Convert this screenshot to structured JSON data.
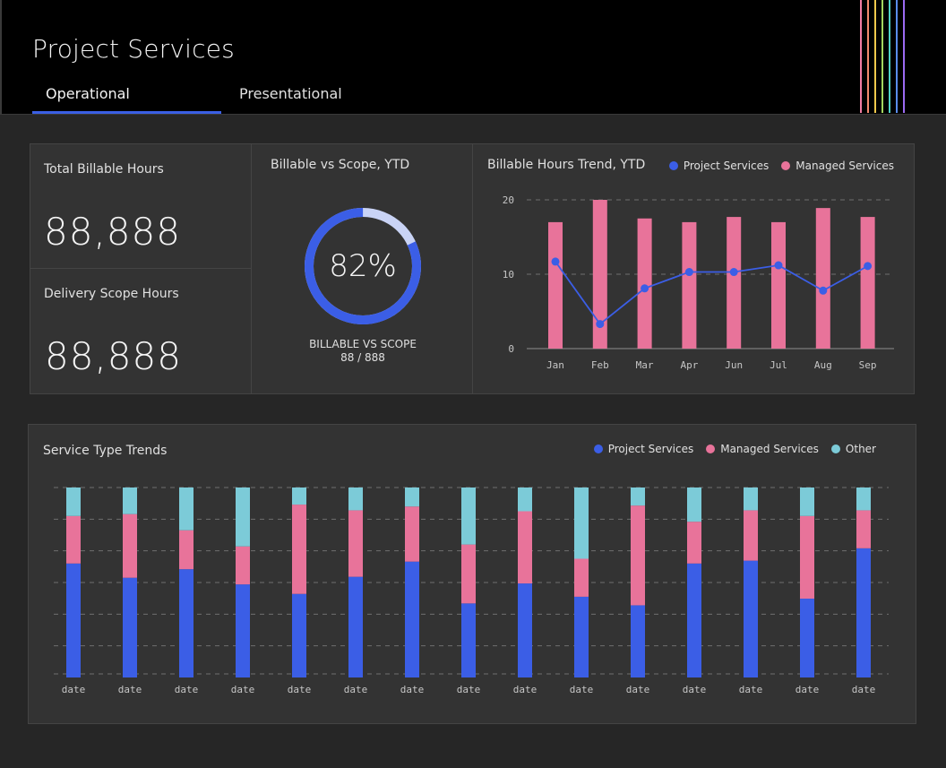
{
  "app": {
    "title": "Project Services"
  },
  "tabs": [
    {
      "label": "Operational",
      "active": true
    },
    {
      "label": "Presentational",
      "active": false
    }
  ],
  "header_stripes": [
    "#f27da3",
    "#f28b6e",
    "#f2c94c",
    "#a4d65e",
    "#4fd1c5",
    "#5a8df0",
    "#9b6bf2"
  ],
  "kpis": {
    "total_billable": {
      "label": "Total Billable Hours",
      "value": "88,888"
    },
    "delivery_scope": {
      "label": "Delivery Scope Hours",
      "value": "88,888"
    }
  },
  "gauge": {
    "title": "Billable vs Scope, YTD",
    "percent_label": "82%",
    "percent": 82,
    "caption": "BILLABLE VS SCOPE",
    "ratio": "88 / 888"
  },
  "colors": {
    "project": "#3b5ee6",
    "managed": "#e8739a",
    "other": "#7ccbd8",
    "gauge_track": "#c9d3f5"
  },
  "trend": {
    "title": "Billable Hours Trend, YTD",
    "legend": [
      "Project Services",
      "Managed Services"
    ]
  },
  "service": {
    "title": "Service Type Trends",
    "legend": [
      "Project Services",
      "Managed Services",
      "Other"
    ]
  },
  "chart_data": [
    {
      "type": "bar",
      "title": "Billable Hours Trend, YTD",
      "categories": [
        "Jan",
        "Feb",
        "Mar",
        "Apr",
        "Jun",
        "Jul",
        "Aug",
        "Sep"
      ],
      "ylim": [
        0,
        20
      ],
      "yticks": [
        0,
        10,
        20
      ],
      "grid": true,
      "legend_position": "top-right",
      "series": [
        {
          "name": "Managed Services",
          "kind": "bar",
          "values": [
            17,
            20,
            17.5,
            17,
            17.7,
            17,
            18.9,
            17.7
          ]
        },
        {
          "name": "Project Services",
          "kind": "line",
          "values": [
            11.7,
            3.3,
            8.1,
            10.3,
            10.3,
            11.2,
            7.8,
            11.1
          ]
        }
      ]
    },
    {
      "type": "bar",
      "stacked": true,
      "title": "Service Type Trends",
      "categories": [
        "date",
        "date",
        "date",
        "date",
        "date",
        "date",
        "date",
        "date",
        "date",
        "date",
        "date",
        "date",
        "date",
        "date",
        "date"
      ],
      "ylim": [
        0,
        100
      ],
      "grid": true,
      "legend_position": "top-right",
      "series": [
        {
          "name": "Project Services",
          "values": [
            60,
            52.5,
            57,
            49,
            44,
            53,
            61,
            39,
            49.5,
            42.5,
            38,
            60,
            61.5,
            41.5,
            68
          ]
        },
        {
          "name": "Managed Services",
          "values": [
            25,
            33.5,
            20.5,
            20,
            47,
            35,
            29,
            31,
            38,
            20,
            52.5,
            22,
            26.5,
            43.5,
            20
          ]
        },
        {
          "name": "Other",
          "values": [
            15,
            14,
            22.5,
            31,
            9,
            12,
            10,
            30,
            12.5,
            37.5,
            9.5,
            18,
            12,
            15,
            12
          ]
        }
      ]
    }
  ]
}
